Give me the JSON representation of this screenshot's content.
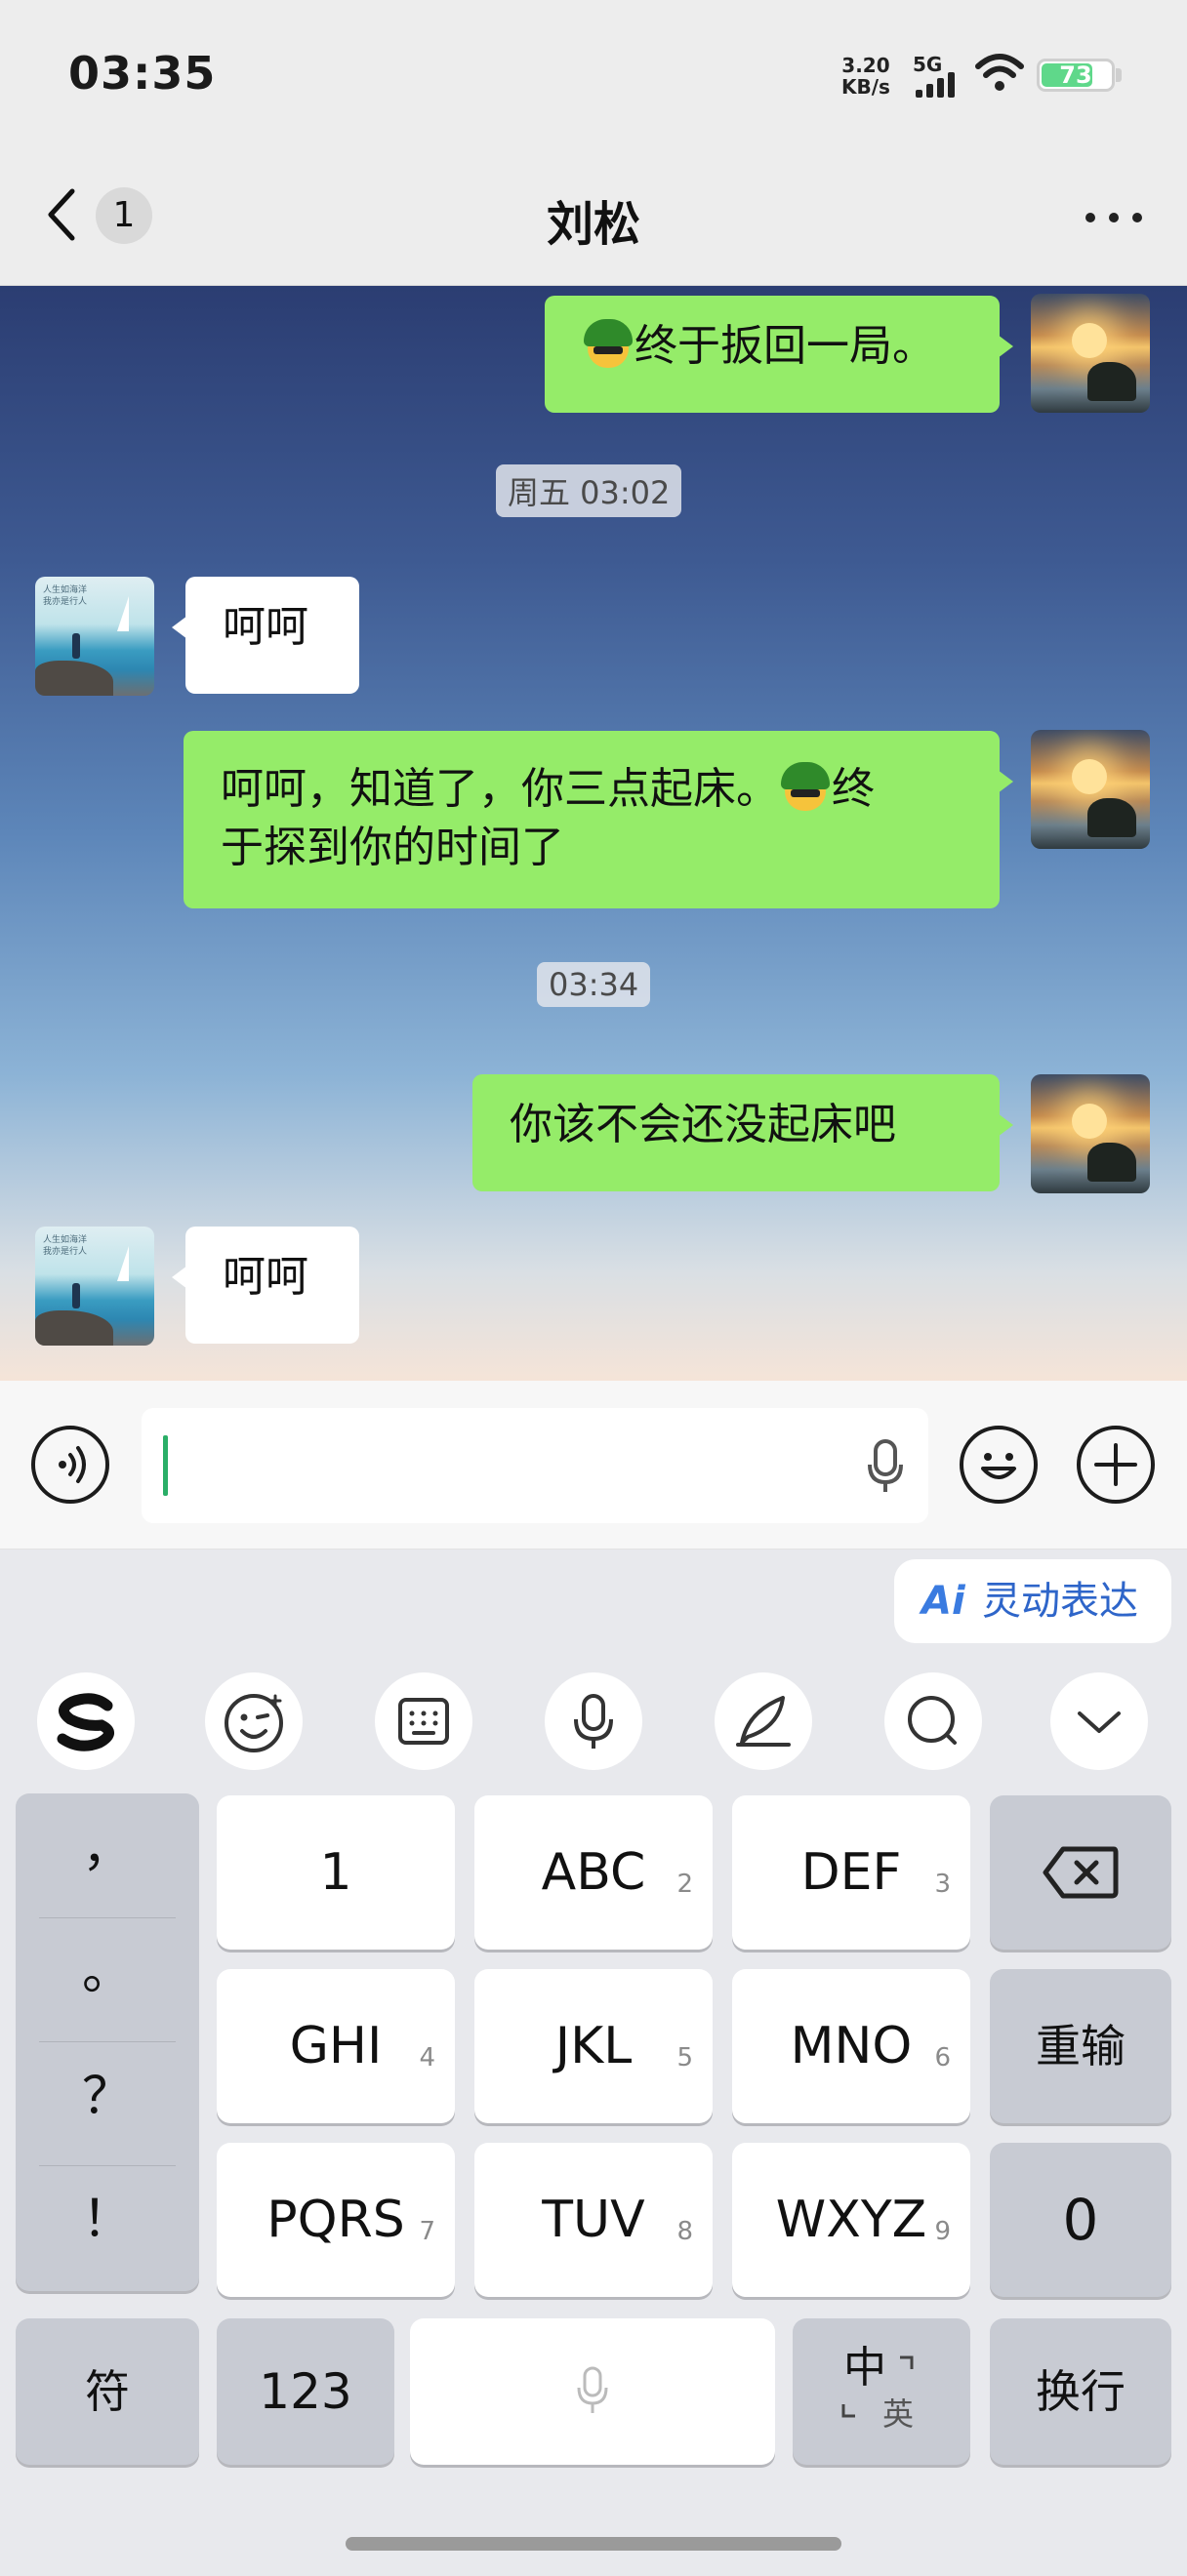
{
  "status_bar": {
    "time": "03:35",
    "net_speed_value": "3.20",
    "net_speed_unit": "KB/s",
    "signal": "5G",
    "battery": "73"
  },
  "nav": {
    "back_count": "1",
    "title": "刘松"
  },
  "messages": [
    {
      "side": "me",
      "text_after_emoji": "终于扳回一局。"
    },
    {
      "kind": "timestamp",
      "text": "周五 03:02"
    },
    {
      "side": "other",
      "text": "呵呵"
    },
    {
      "side": "me",
      "line1_before": "呵呵，知道了，你三点起床。",
      "line1_after": "终",
      "line2": "于探到你的时间了"
    },
    {
      "kind": "timestamp",
      "text": "03:34"
    },
    {
      "side": "me",
      "text": "你该不会还没起床吧"
    },
    {
      "side": "other",
      "text": "呵呵"
    }
  ],
  "input": {
    "value": ""
  },
  "keyboard": {
    "ai_badge": "Ai",
    "ai_label": "灵动表达",
    "punctuation": [
      "，",
      "。",
      "？",
      "！"
    ],
    "rows": [
      [
        {
          "label": "1",
          "num": ""
        },
        {
          "label": "ABC",
          "num": "2"
        },
        {
          "label": "DEF",
          "num": "3"
        }
      ],
      [
        {
          "label": "GHI",
          "num": "4"
        },
        {
          "label": "JKL",
          "num": "5"
        },
        {
          "label": "MNO",
          "num": "6"
        }
      ],
      [
        {
          "label": "PQRS",
          "num": "7"
        },
        {
          "label": "TUV",
          "num": "8"
        },
        {
          "label": "WXYZ",
          "num": "9"
        }
      ]
    ],
    "reenter": "重输",
    "zero": "0",
    "symbols": "符",
    "numbers": "123",
    "lang_main": "中",
    "lang_alt": "英",
    "enter": "换行"
  },
  "colors": {
    "my_bubble": "#95EC69",
    "other_bubble": "#ffffff",
    "cursor": "#2aae67",
    "accent": "#3a7be0"
  }
}
